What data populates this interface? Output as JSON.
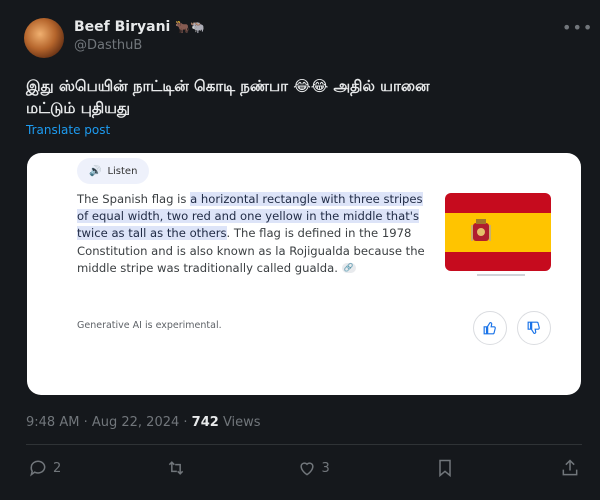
{
  "author": {
    "name": "Beef Biryani",
    "emoji_badges": "🐂🐃",
    "handle": "@DasthuB"
  },
  "tweet": {
    "text_line1": "இது ஸ்பெயின் நாட்டின் கொடி நண்பா 😂😂 அதில் யானை",
    "text_line2": "மட்டும் புதியது"
  },
  "translate_label": "Translate post",
  "card": {
    "listen_label": "Listen",
    "text_before": "The Spanish flag is ",
    "text_highlight": "a horizontal rectangle with three stripes of equal width, two red and one yellow in the middle that's twice as tall as the others",
    "text_after": ". The flag is defined in the 1978 Constitution and is also known as la Rojigualda because the middle stripe was traditionally called gualda.",
    "disclaimer": "Generative AI is experimental."
  },
  "meta": {
    "time": "9:48 AM",
    "date": "Aug 22, 2024",
    "views_count": "742",
    "views_label": "Views"
  },
  "actions": {
    "replies": "2",
    "reposts": "",
    "likes": "3"
  },
  "colors": {
    "link": "#1d9bf0",
    "bg": "#15181c",
    "flag_red": "#c60b1e",
    "flag_yellow": "#ffc400"
  }
}
